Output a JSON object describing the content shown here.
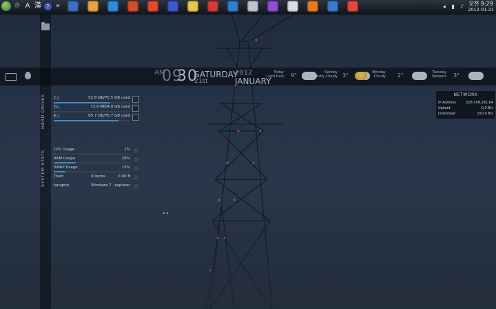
{
  "taskbar": {
    "language": "A",
    "ime": "漢",
    "help": "?",
    "pinned_colors": [
      "#3a6fc2",
      "#e6a23c",
      "#2a8bd8",
      "#d04e2a",
      "#e24a2a",
      "#3c5bd0",
      "#e6c84a",
      "#d43a3a",
      "#2e7fd0",
      "#c0c4cc",
      "#8e4fd2",
      "#d8dde4",
      "#e47c1e",
      "#3a7bd0",
      "#e04a3a"
    ],
    "clock_time": "오전 9:29",
    "clock_date": "2012-01-21"
  },
  "datetime": {
    "ampm": "AM",
    "hour": "09",
    "minute": "30",
    "weekday": "SATURDAY",
    "day": "21st",
    "year": "2012",
    "month": "JANUARY"
  },
  "weather": [
    {
      "day": "Today",
      "condition": "Light Rain",
      "temp": "9°"
    },
    {
      "day": "Sunday",
      "condition": "Mostly Cloudy",
      "temp": "3°"
    },
    {
      "day": "Monday",
      "condition": "Cloudy",
      "temp": "2°"
    },
    {
      "day": "Tuesday",
      "condition": "Showers",
      "temp": "3°"
    }
  ],
  "side_labels": {
    "hard_drives": "HARD DRIVES",
    "system_stats": "SYSTEM STATS"
  },
  "drives": [
    {
      "name": "C:\\",
      "usage": "52.8 GB/70.5 GB used",
      "fraction": 0.749
    },
    {
      "name": "D:\\",
      "usage": "73.9 MB/4.0 GB used",
      "fraction": 0.018
    },
    {
      "name": "E:\\",
      "usage": "65.7 GB/76.7 GB used",
      "fraction": 0.857
    }
  ],
  "stats": [
    {
      "name": "CPU Usage",
      "value": "1%",
      "fraction": 0.01
    },
    {
      "name": "RAM Usage",
      "value": "29%",
      "fraction": 0.29
    },
    {
      "name": "SWAP Usage",
      "value": "15%",
      "fraction": 0.15
    },
    {
      "name": "Trash",
      "middle": "0 items",
      "value": "0.00 B"
    },
    {
      "name": "kangmo",
      "middle": "Windows 7",
      "value": "explorer"
    }
  ],
  "network": {
    "title": "NETWORK",
    "rows": [
      {
        "label": "IP Address",
        "value": "218.149.181.64"
      },
      {
        "label": "Upload",
        "value": "0.0 B/s"
      },
      {
        "label": "Download",
        "value": "150.0 B/s"
      }
    ]
  }
}
